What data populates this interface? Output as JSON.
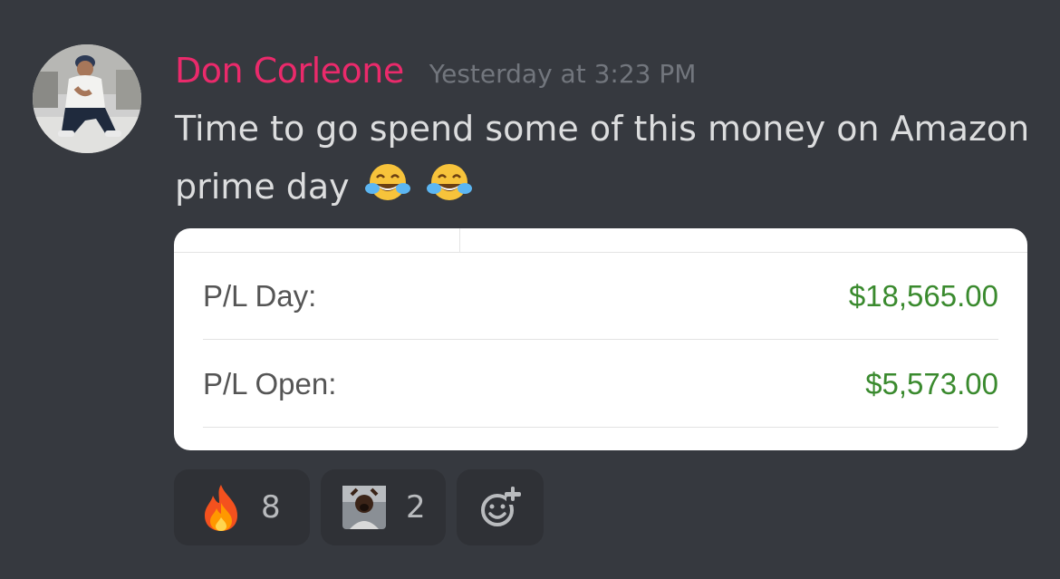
{
  "message": {
    "author": "Don Corleone",
    "timestamp": "Yesterday at 3:23 PM",
    "text": "Time to go spend some of this money on Amazon prime day",
    "inline_emojis": [
      "face-with-tears-of-joy",
      "face-with-tears-of-joy"
    ],
    "colors": {
      "username": "#ea2a6b",
      "background": "#36393f",
      "text": "#dcddde",
      "timestamp": "#72767d"
    }
  },
  "embed": {
    "rows": [
      {
        "label": "P/L Day:",
        "value": "$18,565.00"
      },
      {
        "label": "P/L Open:",
        "value": "$5,573.00"
      }
    ],
    "value_color": "#3a8a2e"
  },
  "reactions": [
    {
      "icon": "fire-icon",
      "count": "8"
    },
    {
      "icon": "custom-emoji-icon",
      "count": "2"
    },
    {
      "icon": "add-reaction-icon",
      "count": ""
    }
  ]
}
